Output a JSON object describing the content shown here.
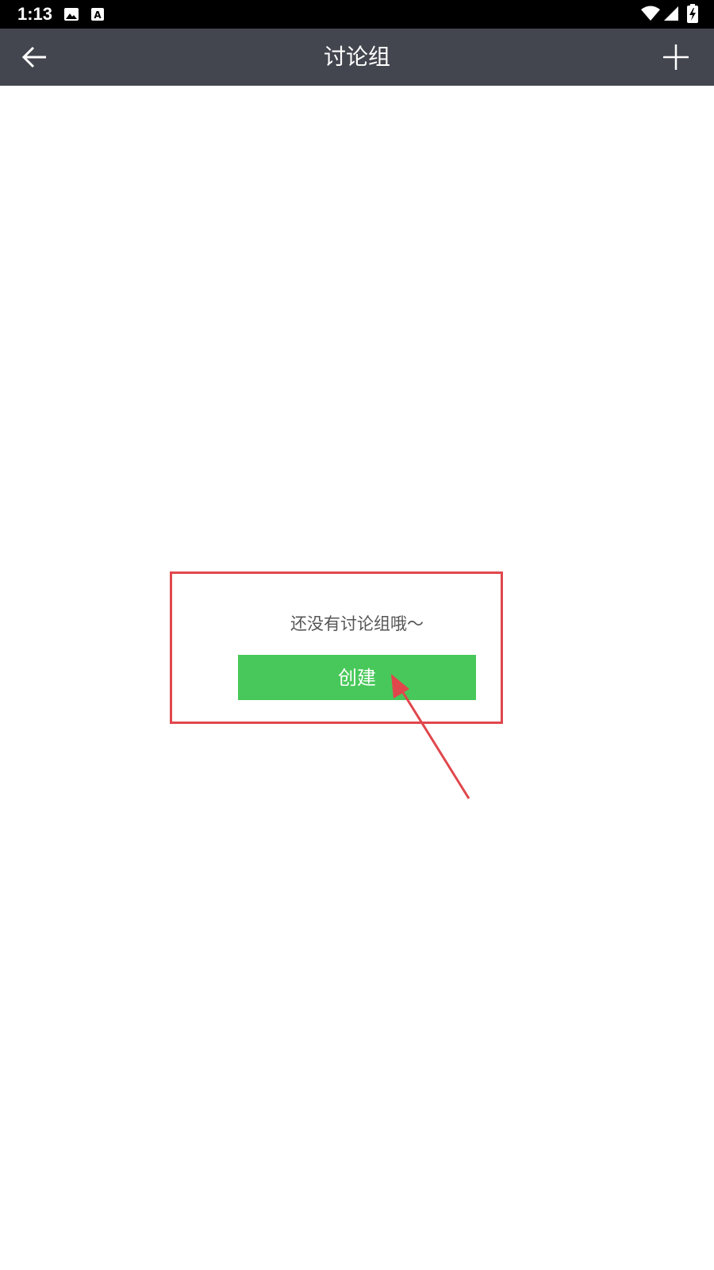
{
  "status_bar": {
    "time": "1:13",
    "icons": [
      "image-icon",
      "font-a-icon",
      "wifi-icon",
      "signal-icon",
      "battery-icon"
    ]
  },
  "toolbar": {
    "title": "讨论组",
    "back_icon": "arrow-left-icon",
    "add_icon": "plus-icon",
    "background": "#43464f"
  },
  "empty_state": {
    "message": "还没有讨论组哦～",
    "create_label": "创建",
    "button_color": "#48c85a"
  },
  "annotation": {
    "color": "#e0474c"
  }
}
